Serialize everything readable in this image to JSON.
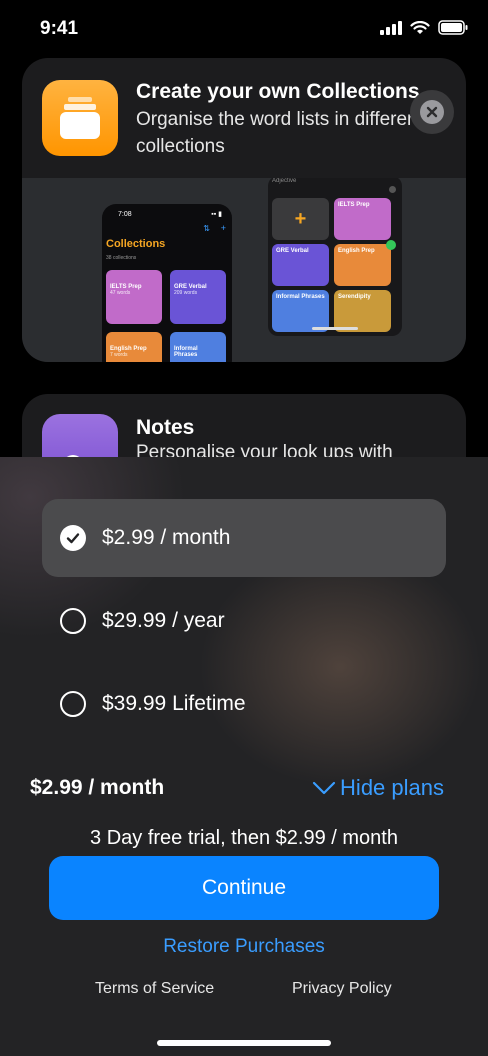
{
  "status": {
    "time": "9:41"
  },
  "collections_card": {
    "title": "Create your own Collections",
    "subtitle": "Organise the word lists in different collections",
    "preview": {
      "phone_time": "7:08",
      "screen_title": "Collections",
      "screen_subtitle": "38 collections",
      "tiles": [
        {
          "label": "IELTS Prep",
          "count": "47 words",
          "color": "#c16bc9"
        },
        {
          "label": "GRE Verbal",
          "count": "209 words",
          "color": "#6a54d6"
        },
        {
          "label": "English Prep",
          "count": "7 words",
          "color": "#e88a3a"
        },
        {
          "label": "Informal Phrases",
          "count": "",
          "color": "#4f7fe0"
        }
      ],
      "picker_label": "Adjective",
      "picker_tiles": [
        "IELTS Prep",
        "GRE Verbal",
        "English Prep",
        "Informal Phrases",
        "Serendipity"
      ],
      "picker_colors": [
        "#c16bc9",
        "#6a54d6",
        "#e88a3a",
        "#4f7fe0",
        "#c99a3a"
      ]
    }
  },
  "notes_card": {
    "title": "Notes",
    "subtitle": "Personalise your look ups with"
  },
  "plans": [
    {
      "label": "$2.99 / month",
      "selected": true
    },
    {
      "label": "$29.99 / year",
      "selected": false
    },
    {
      "label": "$39.99 Lifetime",
      "selected": false
    }
  ],
  "summary": {
    "price": "$2.99 / month",
    "hide_plans": "Hide plans"
  },
  "trial_text": "3 Day free trial, then $2.99 / month",
  "continue_label": "Continue",
  "restore_label": "Restore Purchases",
  "terms_label": "Terms of Service",
  "privacy_label": "Privacy Policy",
  "colors": {
    "accent": "#0a84ff",
    "link": "#3a9dff",
    "collections_icon": "#ff9f0a"
  }
}
